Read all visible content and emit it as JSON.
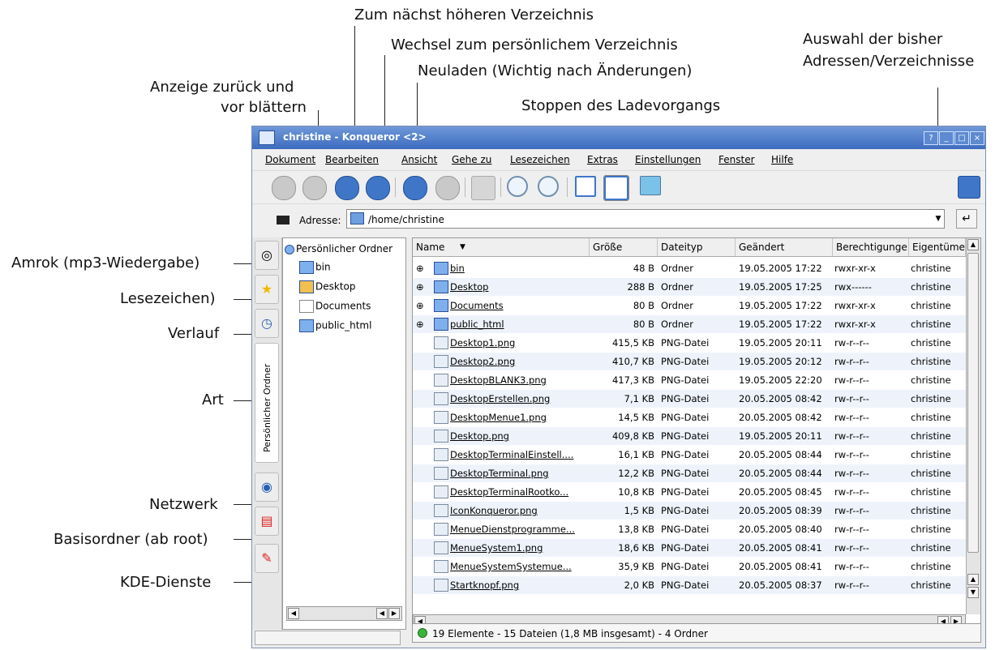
{
  "annotations": {
    "up_dir": "Zum nächst höheren Verzeichnis",
    "home_dir": "Wechsel zum persönlichem Verzeichnis",
    "reload": "Neuladen (Wichtig nach Änderungen)",
    "back_forward_1": "Anzeige zurück und",
    "back_forward_2": "vor blättern",
    "stop": "Stoppen des Ladevorgangs",
    "history_select_1": "Auswahl der bisher",
    "history_select_2": "Adressen/Verzeichnisse",
    "amarok": "Amrok (mp3-Wiedergabe)",
    "bookmarks": "Lesezeichen)",
    "history": "Verlauf",
    "art": "Art",
    "network": "Netzwerk",
    "root_folder": "Basisordner (ab root)",
    "kde_services": "KDE-Dienste"
  },
  "window": {
    "title": "christine - Konqueror <2>",
    "title_buttons": [
      "?",
      "_",
      "□",
      "×"
    ]
  },
  "menu": [
    "Dokument",
    "Bearbeiten",
    "Ansicht",
    "Gehe zu",
    "Lesezeichen",
    "Extras",
    "Einstellungen",
    "Fenster",
    "Hilfe"
  ],
  "address": {
    "label": "Adresse:",
    "value": "/home/christine"
  },
  "sidebar": {
    "vertical_label": "Persönlicher Ordner"
  },
  "tree": {
    "root": "Persönlicher Ordner",
    "items": [
      "bin",
      "Desktop",
      "Documents",
      "public_html"
    ]
  },
  "columns": [
    "Name",
    "Größe",
    "Dateityp",
    "Geändert",
    "Berechtigunge",
    "Eigentüme"
  ],
  "rows": [
    {
      "name": "bin",
      "size": "48 B",
      "type": "Ordner",
      "modified": "19.05.2005 17:22",
      "perm": "rwxr-xr-x",
      "owner": "christine"
    },
    {
      "name": "Desktop",
      "size": "288 B",
      "type": "Ordner",
      "modified": "19.05.2005 17:25",
      "perm": "rwx------",
      "owner": "christine"
    },
    {
      "name": "Documents",
      "size": "80 B",
      "type": "Ordner",
      "modified": "19.05.2005 17:22",
      "perm": "rwxr-xr-x",
      "owner": "christine"
    },
    {
      "name": "public_html",
      "size": "80 B",
      "type": "Ordner",
      "modified": "19.05.2005 17:22",
      "perm": "rwxr-xr-x",
      "owner": "christine"
    },
    {
      "name": "Desktop1.png",
      "size": "415,5 KB",
      "type": "PNG-Datei",
      "modified": "19.05.2005 20:11",
      "perm": "rw-r--r--",
      "owner": "christine"
    },
    {
      "name": "Desktop2.png",
      "size": "410,7 KB",
      "type": "PNG-Datei",
      "modified": "19.05.2005 20:12",
      "perm": "rw-r--r--",
      "owner": "christine"
    },
    {
      "name": "DesktopBLANK3.png",
      "size": "417,3 KB",
      "type": "PNG-Datei",
      "modified": "19.05.2005 22:20",
      "perm": "rw-r--r--",
      "owner": "christine"
    },
    {
      "name": "DesktopErstellen.png",
      "size": "7,1 KB",
      "type": "PNG-Datei",
      "modified": "20.05.2005 08:42",
      "perm": "rw-r--r--",
      "owner": "christine"
    },
    {
      "name": "DesktopMenue1.png",
      "size": "14,5 KB",
      "type": "PNG-Datei",
      "modified": "20.05.2005 08:42",
      "perm": "rw-r--r--",
      "owner": "christine"
    },
    {
      "name": "Desktop.png",
      "size": "409,8 KB",
      "type": "PNG-Datei",
      "modified": "19.05.2005 20:11",
      "perm": "rw-r--r--",
      "owner": "christine"
    },
    {
      "name": "DesktopTerminalEinstell....",
      "size": "16,1 KB",
      "type": "PNG-Datei",
      "modified": "20.05.2005 08:44",
      "perm": "rw-r--r--",
      "owner": "christine"
    },
    {
      "name": "DesktopTerminal.png",
      "size": "12,2 KB",
      "type": "PNG-Datei",
      "modified": "20.05.2005 08:44",
      "perm": "rw-r--r--",
      "owner": "christine"
    },
    {
      "name": "DesktopTerminalRootko...",
      "size": "10,8 KB",
      "type": "PNG-Datei",
      "modified": "20.05.2005 08:45",
      "perm": "rw-r--r--",
      "owner": "christine"
    },
    {
      "name": "IconKonqueror.png",
      "size": "1,5 KB",
      "type": "PNG-Datei",
      "modified": "20.05.2005 08:39",
      "perm": "rw-r--r--",
      "owner": "christine"
    },
    {
      "name": "MenueDienstprogramme...",
      "size": "13,8 KB",
      "type": "PNG-Datei",
      "modified": "20.05.2005 08:40",
      "perm": "rw-r--r--",
      "owner": "christine"
    },
    {
      "name": "MenueSystem1.png",
      "size": "18,6 KB",
      "type": "PNG-Datei",
      "modified": "20.05.2005 08:41",
      "perm": "rw-r--r--",
      "owner": "christine"
    },
    {
      "name": "MenueSystemSystemue...",
      "size": "35,9 KB",
      "type": "PNG-Datei",
      "modified": "20.05.2005 08:41",
      "perm": "rw-r--r--",
      "owner": "christine"
    },
    {
      "name": "Startknopf.png",
      "size": "2,0 KB",
      "type": "PNG-Datei",
      "modified": "20.05.2005 08:37",
      "perm": "rw-r--r--",
      "owner": "christine"
    }
  ],
  "status": "19 Elemente - 15 Dateien (1,8 MB insgesamt) - 4 Ordner"
}
